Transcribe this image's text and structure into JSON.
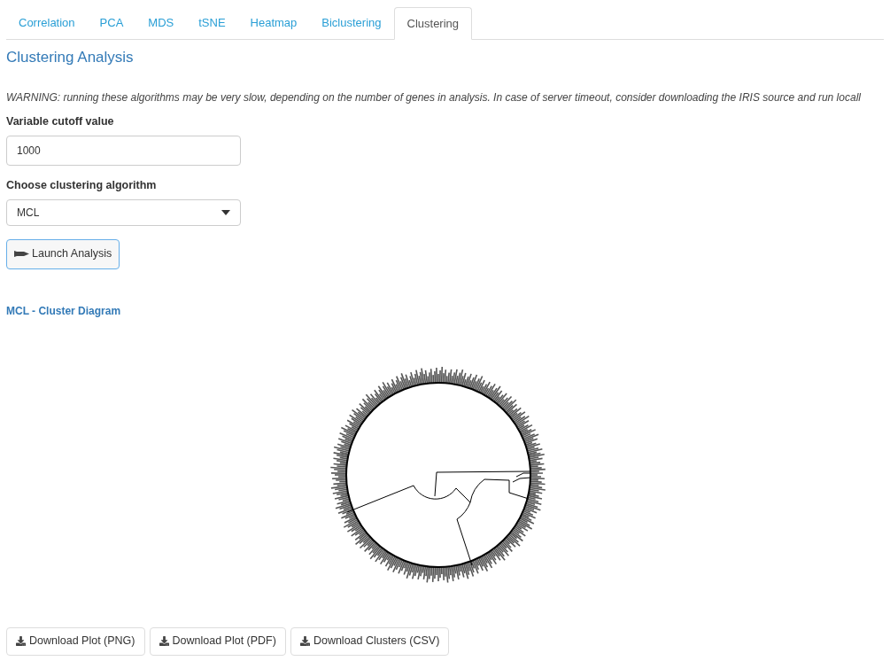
{
  "tabs": [
    {
      "label": "Correlation",
      "selected": false
    },
    {
      "label": "PCA",
      "selected": false
    },
    {
      "label": "MDS",
      "selected": false
    },
    {
      "label": "tSNE",
      "selected": false
    },
    {
      "label": "Heatmap",
      "selected": false
    },
    {
      "label": "Biclustering",
      "selected": false
    },
    {
      "label": "Clustering",
      "selected": true
    }
  ],
  "title": "Clustering Analysis",
  "warning": "WARNING: running these algorithms may be very slow, depending on the number of genes in analysis. In case of server timeout, consider downloading the IRIS source and run locall",
  "cutoff": {
    "label": "Variable cutoff value",
    "value": "1000"
  },
  "algorithm": {
    "label": "Choose clustering algorithm",
    "value": "MCL"
  },
  "launch_button": "Launch Analysis",
  "plot": {
    "title": "MCL - Cluster Diagram",
    "kind": "picture"
  },
  "download_buttons": [
    "Download Plot (PNG)",
    "Download Plot (PDF)",
    "Download Clusters (CSV)"
  ]
}
